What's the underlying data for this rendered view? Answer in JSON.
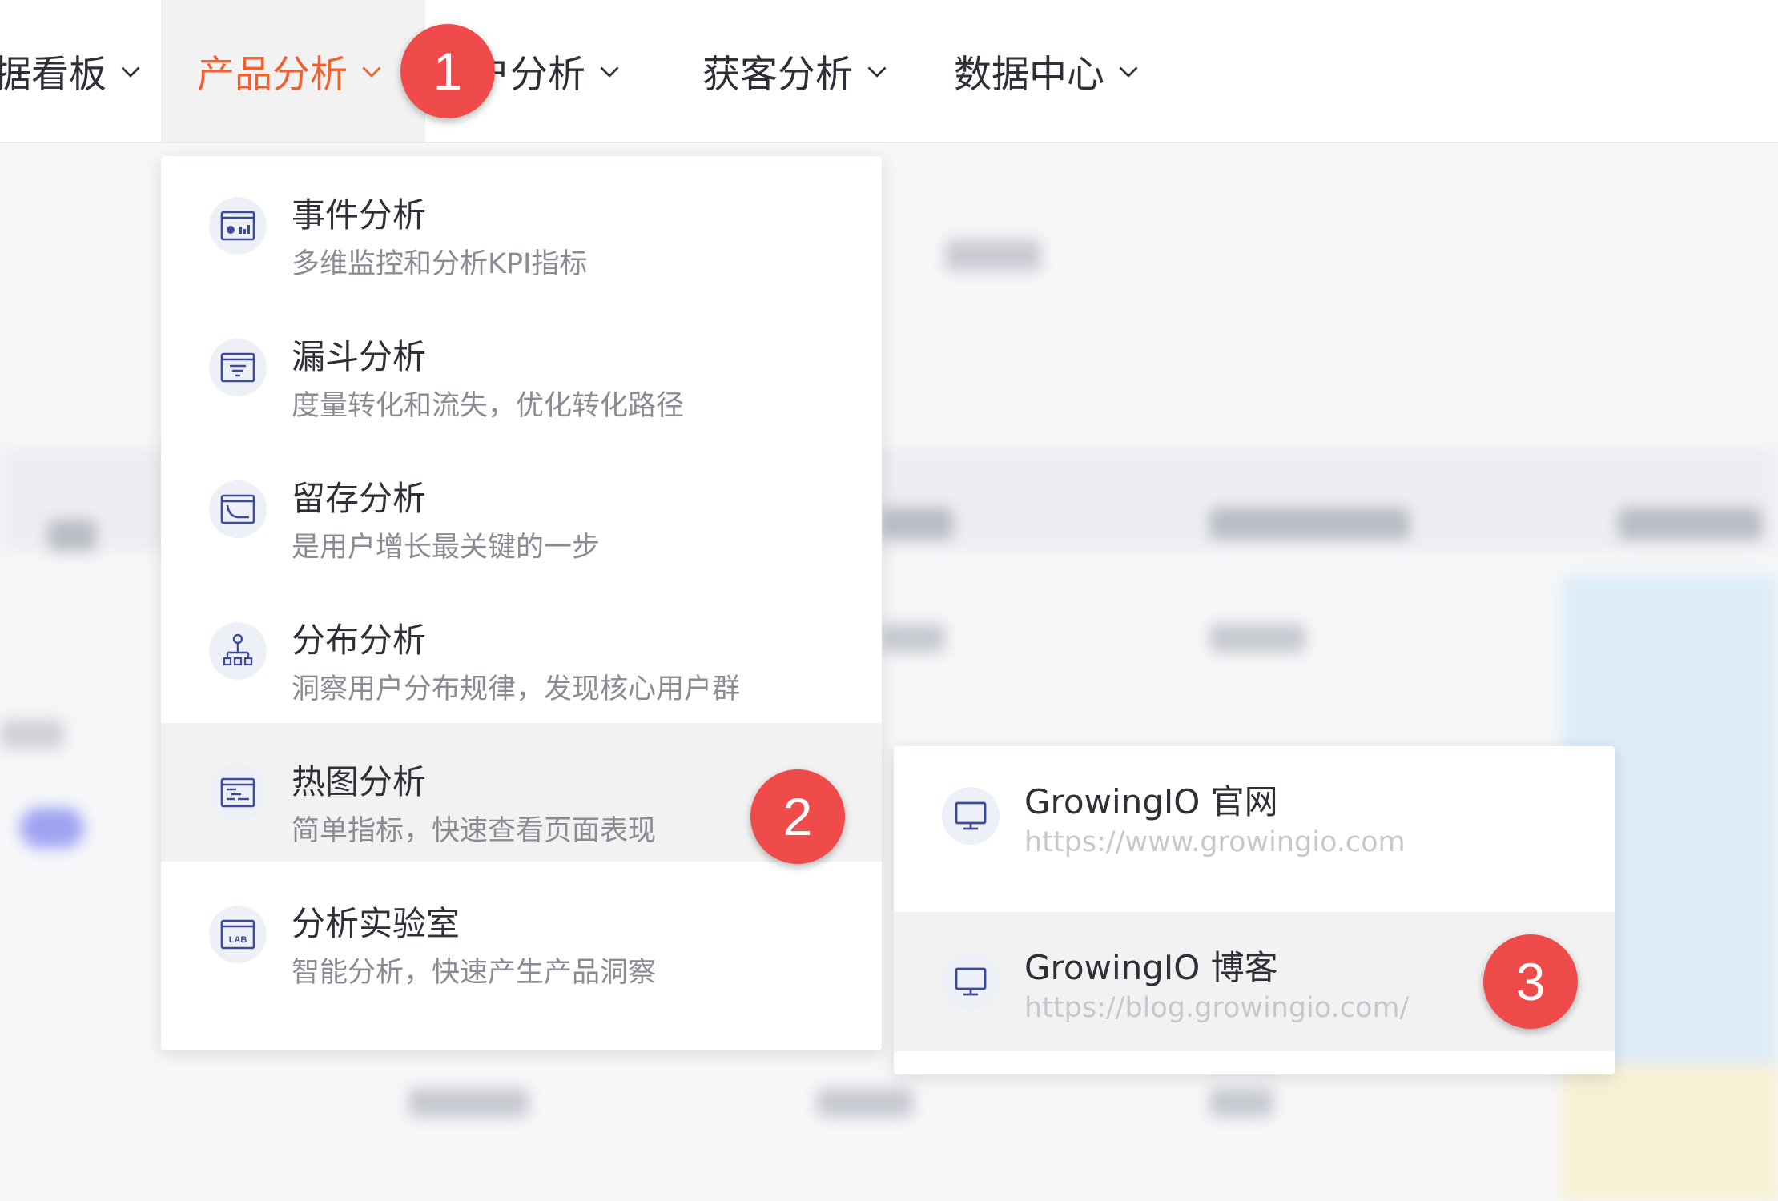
{
  "topnav": {
    "items": [
      {
        "label": "据看板",
        "icon": "chevron-down-icon"
      },
      {
        "label": "产品分析",
        "icon": "chevron-down-icon",
        "active": true
      },
      {
        "label": "户分析",
        "icon": "chevron-down-icon"
      },
      {
        "label": "获客分析",
        "icon": "chevron-down-icon"
      },
      {
        "label": "数据中心",
        "icon": "chevron-down-icon"
      }
    ]
  },
  "badges": [
    "1",
    "2",
    "3"
  ],
  "menu": {
    "items": [
      {
        "title": "事件分析",
        "desc": "多维监控和分析KPI指标",
        "icon": "event-chart-icon"
      },
      {
        "title": "漏斗分析",
        "desc": "度量转化和流失，优化转化路径",
        "icon": "funnel-icon"
      },
      {
        "title": "留存分析",
        "desc": "是用户增长最关键的一步",
        "icon": "retention-curve-icon"
      },
      {
        "title": "分布分析",
        "desc": "洞察用户分布规律，发现核心用户群",
        "icon": "distribution-tree-icon"
      },
      {
        "title": "热图分析",
        "desc": "简单指标，快速查看页面表现",
        "icon": "heatmap-icon",
        "active": true
      },
      {
        "title": "分析实验室",
        "desc": "智能分析，快速产生产品洞察",
        "icon": "lab-icon",
        "icon_text": "LAB"
      }
    ]
  },
  "submenu": {
    "items": [
      {
        "title": "GrowingIO 官网",
        "url": "https://www.growingio.com",
        "icon": "monitor-icon"
      },
      {
        "title": "GrowingIO 博客",
        "url": "https://blog.growingio.com/",
        "icon": "monitor-icon",
        "active": true
      }
    ]
  },
  "colors": {
    "accent": "#f0602e",
    "badge": "#ef4b4b",
    "icon": "#3b4a9a",
    "active_bg": "#f2f2f2"
  }
}
